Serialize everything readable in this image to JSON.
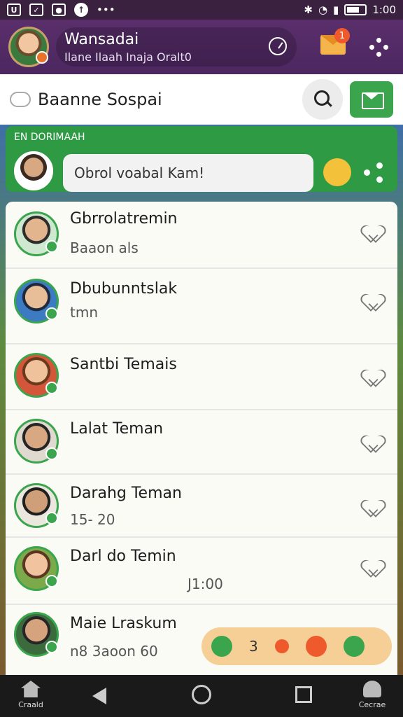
{
  "status_bar": {
    "time": "1:00"
  },
  "header": {
    "title": "Wansadai",
    "subtitle": "Ilane Ilaah Inaja Oralt0",
    "mail_badge_count": "1"
  },
  "search": {
    "text": "Baanne Sospai"
  },
  "green_bar": {
    "label": "EN DORIMAAH",
    "compose_text": "Obrol voabal Kam!"
  },
  "list": [
    {
      "name": "Gbrrolatremin",
      "meta": "Baaon als"
    },
    {
      "name": "Dbubunntslak",
      "meta": "tmn"
    },
    {
      "name": "Santbi Temais",
      "meta": ""
    },
    {
      "name": "Lalat Teman",
      "meta": ""
    },
    {
      "name": "Darahg Teman",
      "meta": "15- 20"
    },
    {
      "name": "Darl do Temin",
      "meta": "J1:00"
    },
    {
      "name": "Maie Lraskum",
      "meta": "n8 3aoon 60"
    }
  ],
  "bottom_pill": {
    "count": "3"
  },
  "nav": {
    "left_label": "Craald",
    "right_label": "Cecrae"
  },
  "colors": {
    "primary_purple": "#4c2760",
    "accent_green": "#3aa54d",
    "badge_orange": "#ef5a2d"
  }
}
